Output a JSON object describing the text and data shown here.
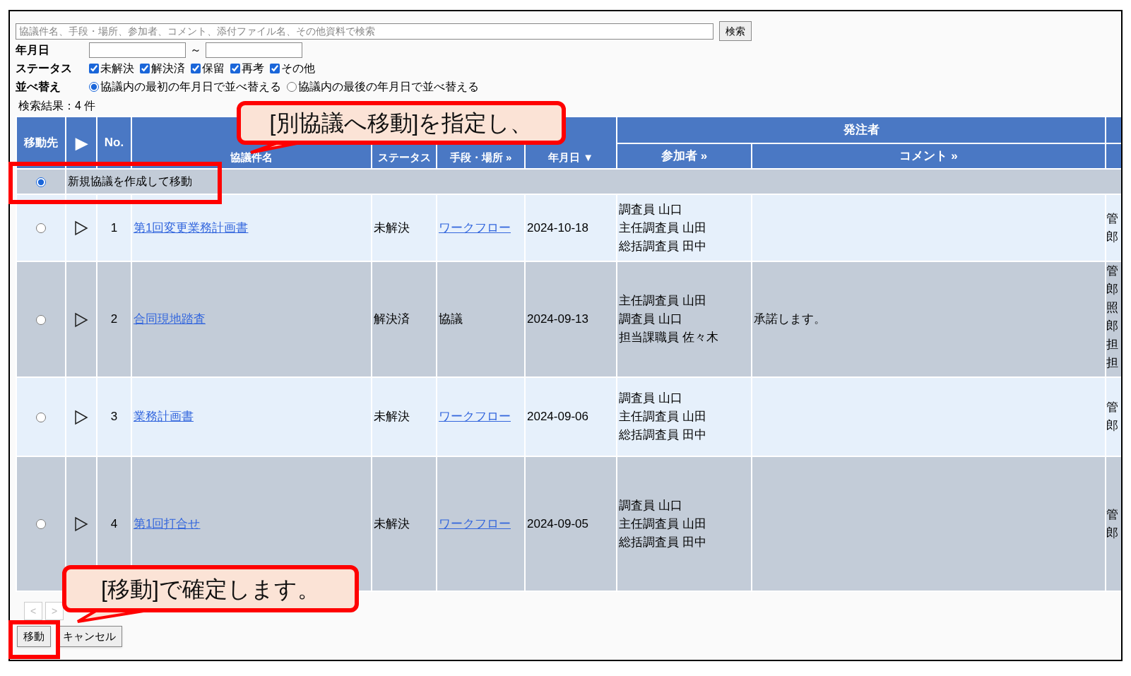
{
  "search": {
    "placeholder": "協議件名、手段・場所、参加者、コメント、添付ファイル名、その他資料で検索",
    "button": "検索"
  },
  "date_filter": {
    "label": "年月日",
    "separator": "～"
  },
  "status_filter": {
    "label": "ステータス",
    "options": [
      {
        "label": "未解決",
        "checked": true
      },
      {
        "label": "解決済",
        "checked": true
      },
      {
        "label": "保留",
        "checked": true
      },
      {
        "label": "再考",
        "checked": true
      },
      {
        "label": "その他",
        "checked": true
      }
    ]
  },
  "sort": {
    "label": "並べ替え",
    "options": [
      {
        "label": "協議内の最初の年月日で並べ替える",
        "selected": true
      },
      {
        "label": "協議内の最後の年月日で並べ替える",
        "selected": false
      }
    ]
  },
  "result_count": "検索結果：4 件",
  "table": {
    "columns": [
      "移動先",
      "▶",
      "No.",
      "協議件名",
      "ステータス",
      "手段・場所 »",
      "年月日 ▼"
    ],
    "group_header": "発注者",
    "sub_columns": [
      "参加者 »",
      "コメント »"
    ],
    "new_row": {
      "label": "新規協議を作成して移動",
      "selected": true
    },
    "rows": [
      {
        "selected": false,
        "no": "1",
        "title": "第1回変更業務計画書",
        "status": "未解決",
        "method": "ワークフロー",
        "method_link": true,
        "date": "2024-10-18",
        "participants": [
          "調査員 山口",
          "主任調査員 山田",
          "総括調査員 田中"
        ],
        "column_10": [
          "管",
          "郎"
        ]
      },
      {
        "selected": false,
        "no": "2",
        "title": "合同現地踏査",
        "status": "解決済",
        "method": "協議",
        "method_link": false,
        "date": "2024-09-13",
        "participants": [
          "主任調査員 山田",
          "調査員 山口",
          "担当課職員 佐々木"
        ],
        "comment": "承諾します。",
        "column_10": [
          "管",
          "郎",
          "照",
          "郎",
          "担",
          "担"
        ]
      },
      {
        "selected": false,
        "no": "3",
        "title": "業務計画書",
        "status": "未解決",
        "method": "ワークフロー",
        "method_link": true,
        "date": "2024-09-06",
        "participants": [
          "調査員 山口",
          "主任調査員 山田",
          "総括調査員 田中"
        ],
        "column_10": [
          "管",
          "郎"
        ]
      },
      {
        "selected": false,
        "no": "4",
        "title": "第1回打合せ",
        "status": "未解決",
        "method": "ワークフロー",
        "method_link": true,
        "date": "2024-09-05",
        "participants": [
          "調査員 山口",
          "主任調査員 山田",
          "総括調査員 田中"
        ],
        "column_10": [
          "管",
          "郎"
        ]
      }
    ]
  },
  "pager": [
    "<",
    ">"
  ],
  "buttons": [
    "移動",
    "キャンセル"
  ],
  "callouts": [
    {
      "text": "[別協議へ移動]を指定し、"
    },
    {
      "text": "[移動]で確定します。"
    }
  ]
}
